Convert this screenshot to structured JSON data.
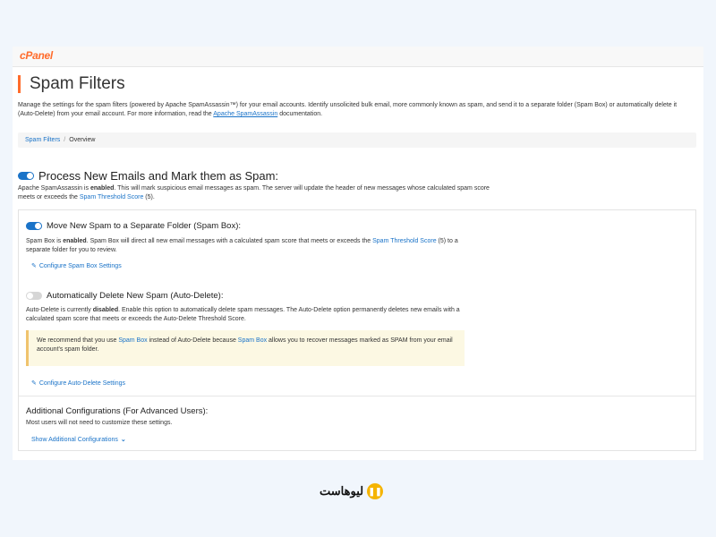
{
  "app": {
    "logo": "cPanel"
  },
  "page": {
    "title": "Spam Filters",
    "desc_1": "Manage the settings for the spam filters (powered by Apache SpamAssassin™) for your email accounts. Identify unsolicited bulk email, more commonly known as spam, and send it to a separate folder (Spam Box) or automatically delete it (Auto-Delete) from your email account. For more information, read the ",
    "desc_link": "Apache SpamAssassin",
    "desc_2": " documentation."
  },
  "breadcrumb": {
    "item1": "Spam Filters",
    "sep": "/",
    "item2": "Overview"
  },
  "process": {
    "heading": "Process New Emails and Mark them as Spam:",
    "desc_1": "Apache SpamAssassin is ",
    "desc_bold": "enabled",
    "desc_2": ". This will mark suspicious email messages as spam. The server will update the header of new messages whose calculated spam score meets or exceeds the ",
    "desc_link": "Spam Threshold Score",
    "desc_3": " (5).",
    "enabled": true
  },
  "spambox": {
    "heading": "Move New Spam to a Separate Folder (Spam Box):",
    "desc_1": "Spam Box is ",
    "desc_bold": "enabled",
    "desc_2": ". Spam Box will direct all new email messages with a calculated spam score that meets or exceeds the ",
    "desc_link": "Spam Threshold Score",
    "desc_3": " (5) to a separate folder for you to review.",
    "action": "Configure Spam Box Settings",
    "enabled": true
  },
  "autodelete": {
    "heading": "Automatically Delete New Spam (Auto-Delete):",
    "desc_1": "Auto-Delete is currently ",
    "desc_bold": "disabled",
    "desc_2": ". Enable this option to automatically delete spam messages. The Auto-Delete option permanently deletes new emails with a calculated spam score that meets or exceeds the Auto-Delete Threshold Score.",
    "notice_1": "We recommend that you use ",
    "notice_link1": "Spam Box",
    "notice_2": " instead of Auto-Delete because ",
    "notice_link2": "Spam Box",
    "notice_3": " allows you to recover messages marked as SPAM from your email account's spam folder.",
    "action": "Configure Auto-Delete Settings",
    "enabled": false
  },
  "advanced": {
    "heading": "Additional Configurations (For Advanced Users):",
    "desc": "Most users will not need to customize these settings.",
    "action": "Show Additional Configurations"
  },
  "watermark": {
    "name": "ليوهاست"
  },
  "colors": {
    "accent": "#1a73c8",
    "brand": "#ff6c2c",
    "notice_bg": "#fcf8e3"
  },
  "icons": {
    "edit": "pencil-icon",
    "expand": "chevron-down-icon",
    "toggle_on": "toggle-on-icon",
    "toggle_off": "toggle-off-icon"
  }
}
